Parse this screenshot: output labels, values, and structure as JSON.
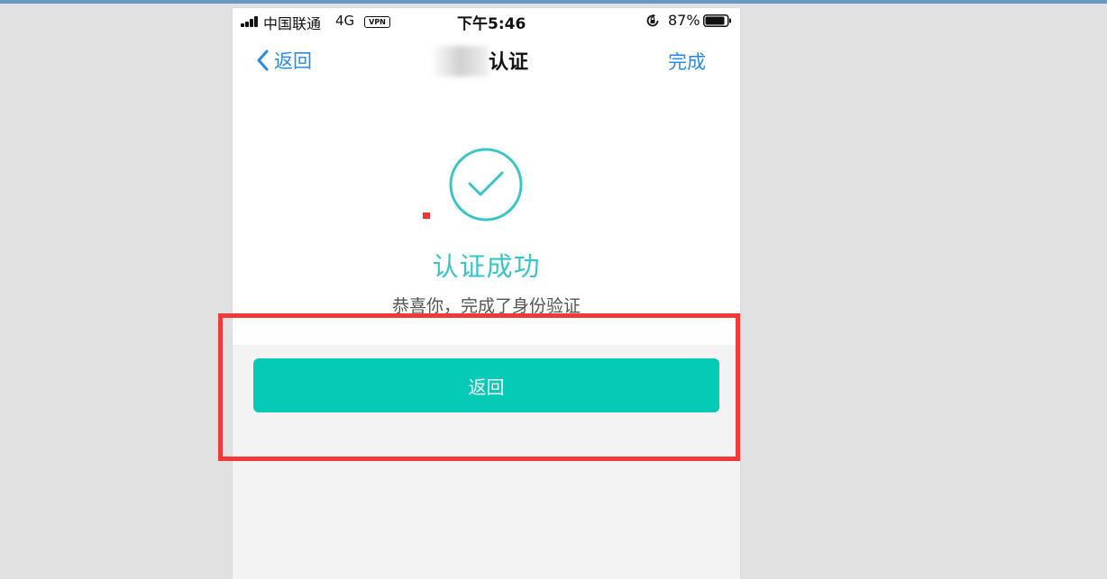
{
  "status_bar": {
    "carrier": "中国联通",
    "network": "4G",
    "vpn": "VPN",
    "time": "下午5:46",
    "battery": "87%"
  },
  "nav": {
    "back_label": "返回",
    "title": "认证",
    "done_label": "完成"
  },
  "result": {
    "title": "认证成功",
    "subtitle": "恭喜你，完成了身份验证"
  },
  "action": {
    "button_label": "返回"
  },
  "colors": {
    "accent": "#05cbb6",
    "success_text": "#35c7c6",
    "nav_link": "#2a8ae8",
    "highlight": "#f03a3a"
  }
}
